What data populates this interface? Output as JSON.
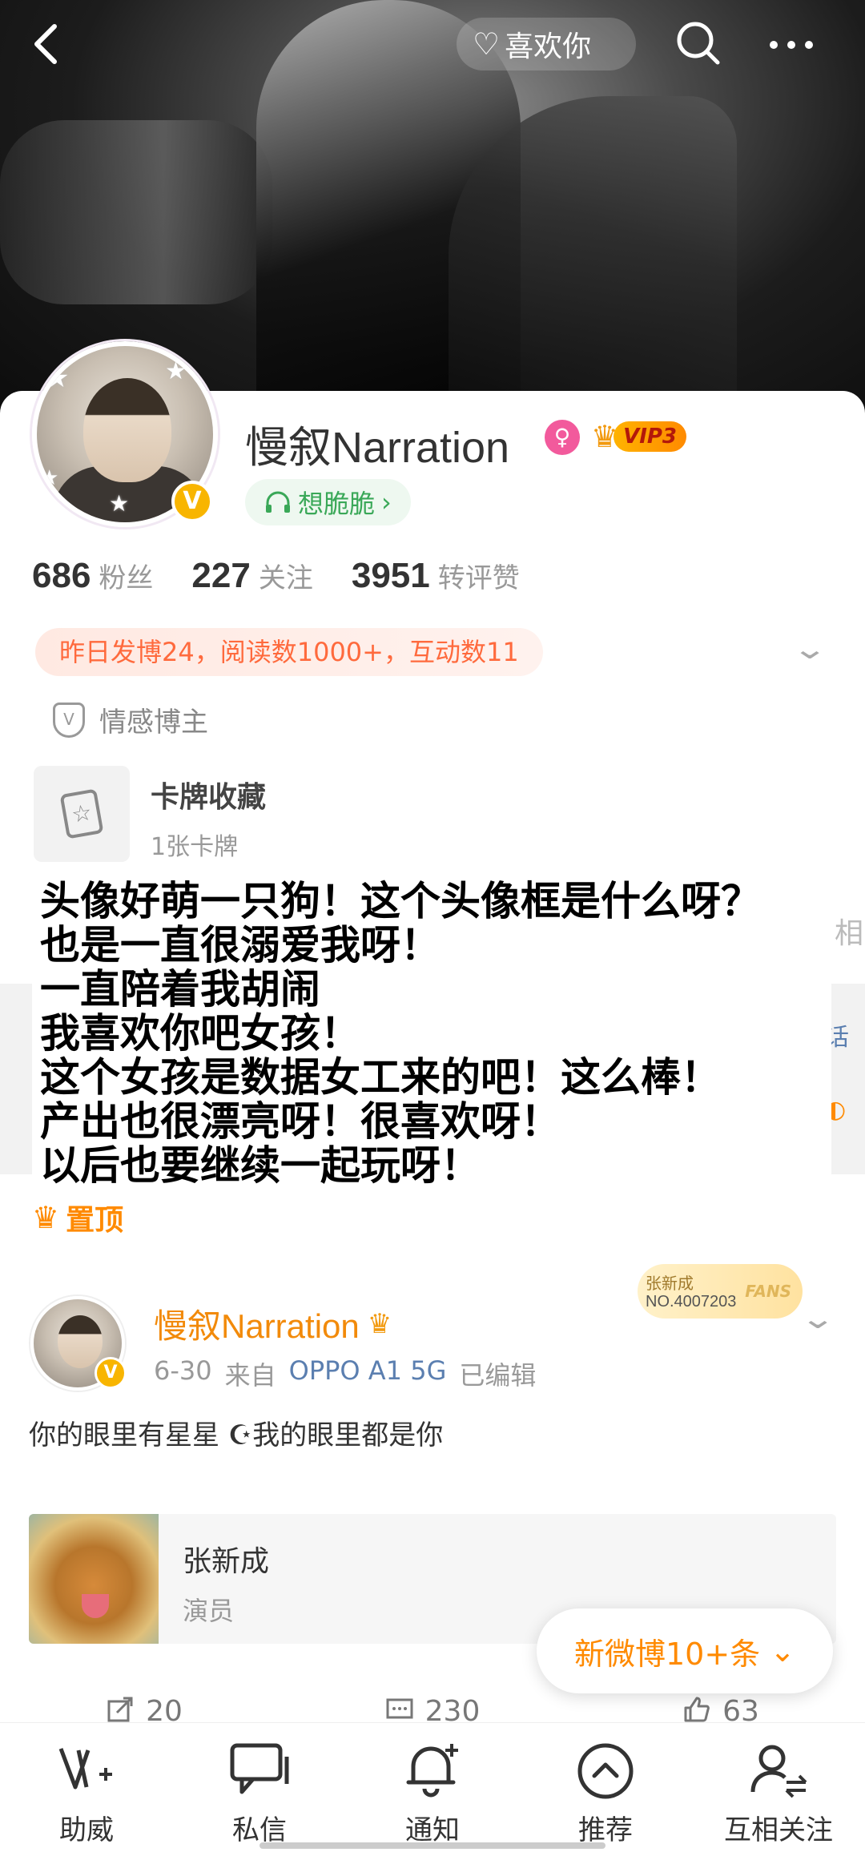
{
  "header": {
    "like_label": "喜欢你"
  },
  "profile": {
    "name": "慢叙Narration",
    "vip_label": "VIP3",
    "verified_badge": "V",
    "music_label": "想脆脆",
    "stats": [
      {
        "value": "686",
        "label": "粉丝"
      },
      {
        "value": "227",
        "label": "关注"
      },
      {
        "value": "3951",
        "label": "转评赞"
      }
    ],
    "summary": "昨日发博24，阅读数1000+，互动数11",
    "tagline": "情感博主",
    "cards": {
      "title": "卡牌收藏",
      "subtitle": "1张卡牌"
    }
  },
  "overlay_text": [
    "头像好萌一只狗！这个头像框是什么呀？",
    "也是一直很溺爱我呀！",
    "一直陪着我胡闹",
    "我喜欢你吧女孩！",
    "这个女孩是数据女工来的吧！这么棒！",
    "产出也很漂亮呀！很喜欢呀！",
    " 以后也要继续一起玩呀！"
  ],
  "pinned_label": "置顶",
  "post": {
    "author": "慢叙Narration",
    "date": "6-30",
    "source_prefix": "来自",
    "source": "OPPO A1 5G",
    "edited": "已编辑",
    "fans_badge": {
      "name": "张新成",
      "number": "NO.4007203",
      "tag": "FANS"
    },
    "text": "你的眼里有星星 ☪我的眼里都是你",
    "link_card": {
      "title": "张新成",
      "subtitle": "演员"
    },
    "actions": [
      {
        "icon": "repost-icon",
        "count": "20"
      },
      {
        "icon": "comment-icon",
        "count": "230"
      },
      {
        "icon": "like-icon",
        "count": "63"
      }
    ]
  },
  "new_posts_label": "新微博10+条",
  "bottom_nav": [
    {
      "label": "助威",
      "icon": "cheer-icon"
    },
    {
      "label": "私信",
      "icon": "message-icon"
    },
    {
      "label": "通知",
      "icon": "bell-icon"
    },
    {
      "label": "推荐",
      "icon": "recommend-icon"
    },
    {
      "label": "互相关注",
      "icon": "mutual-follow-icon"
    }
  ]
}
